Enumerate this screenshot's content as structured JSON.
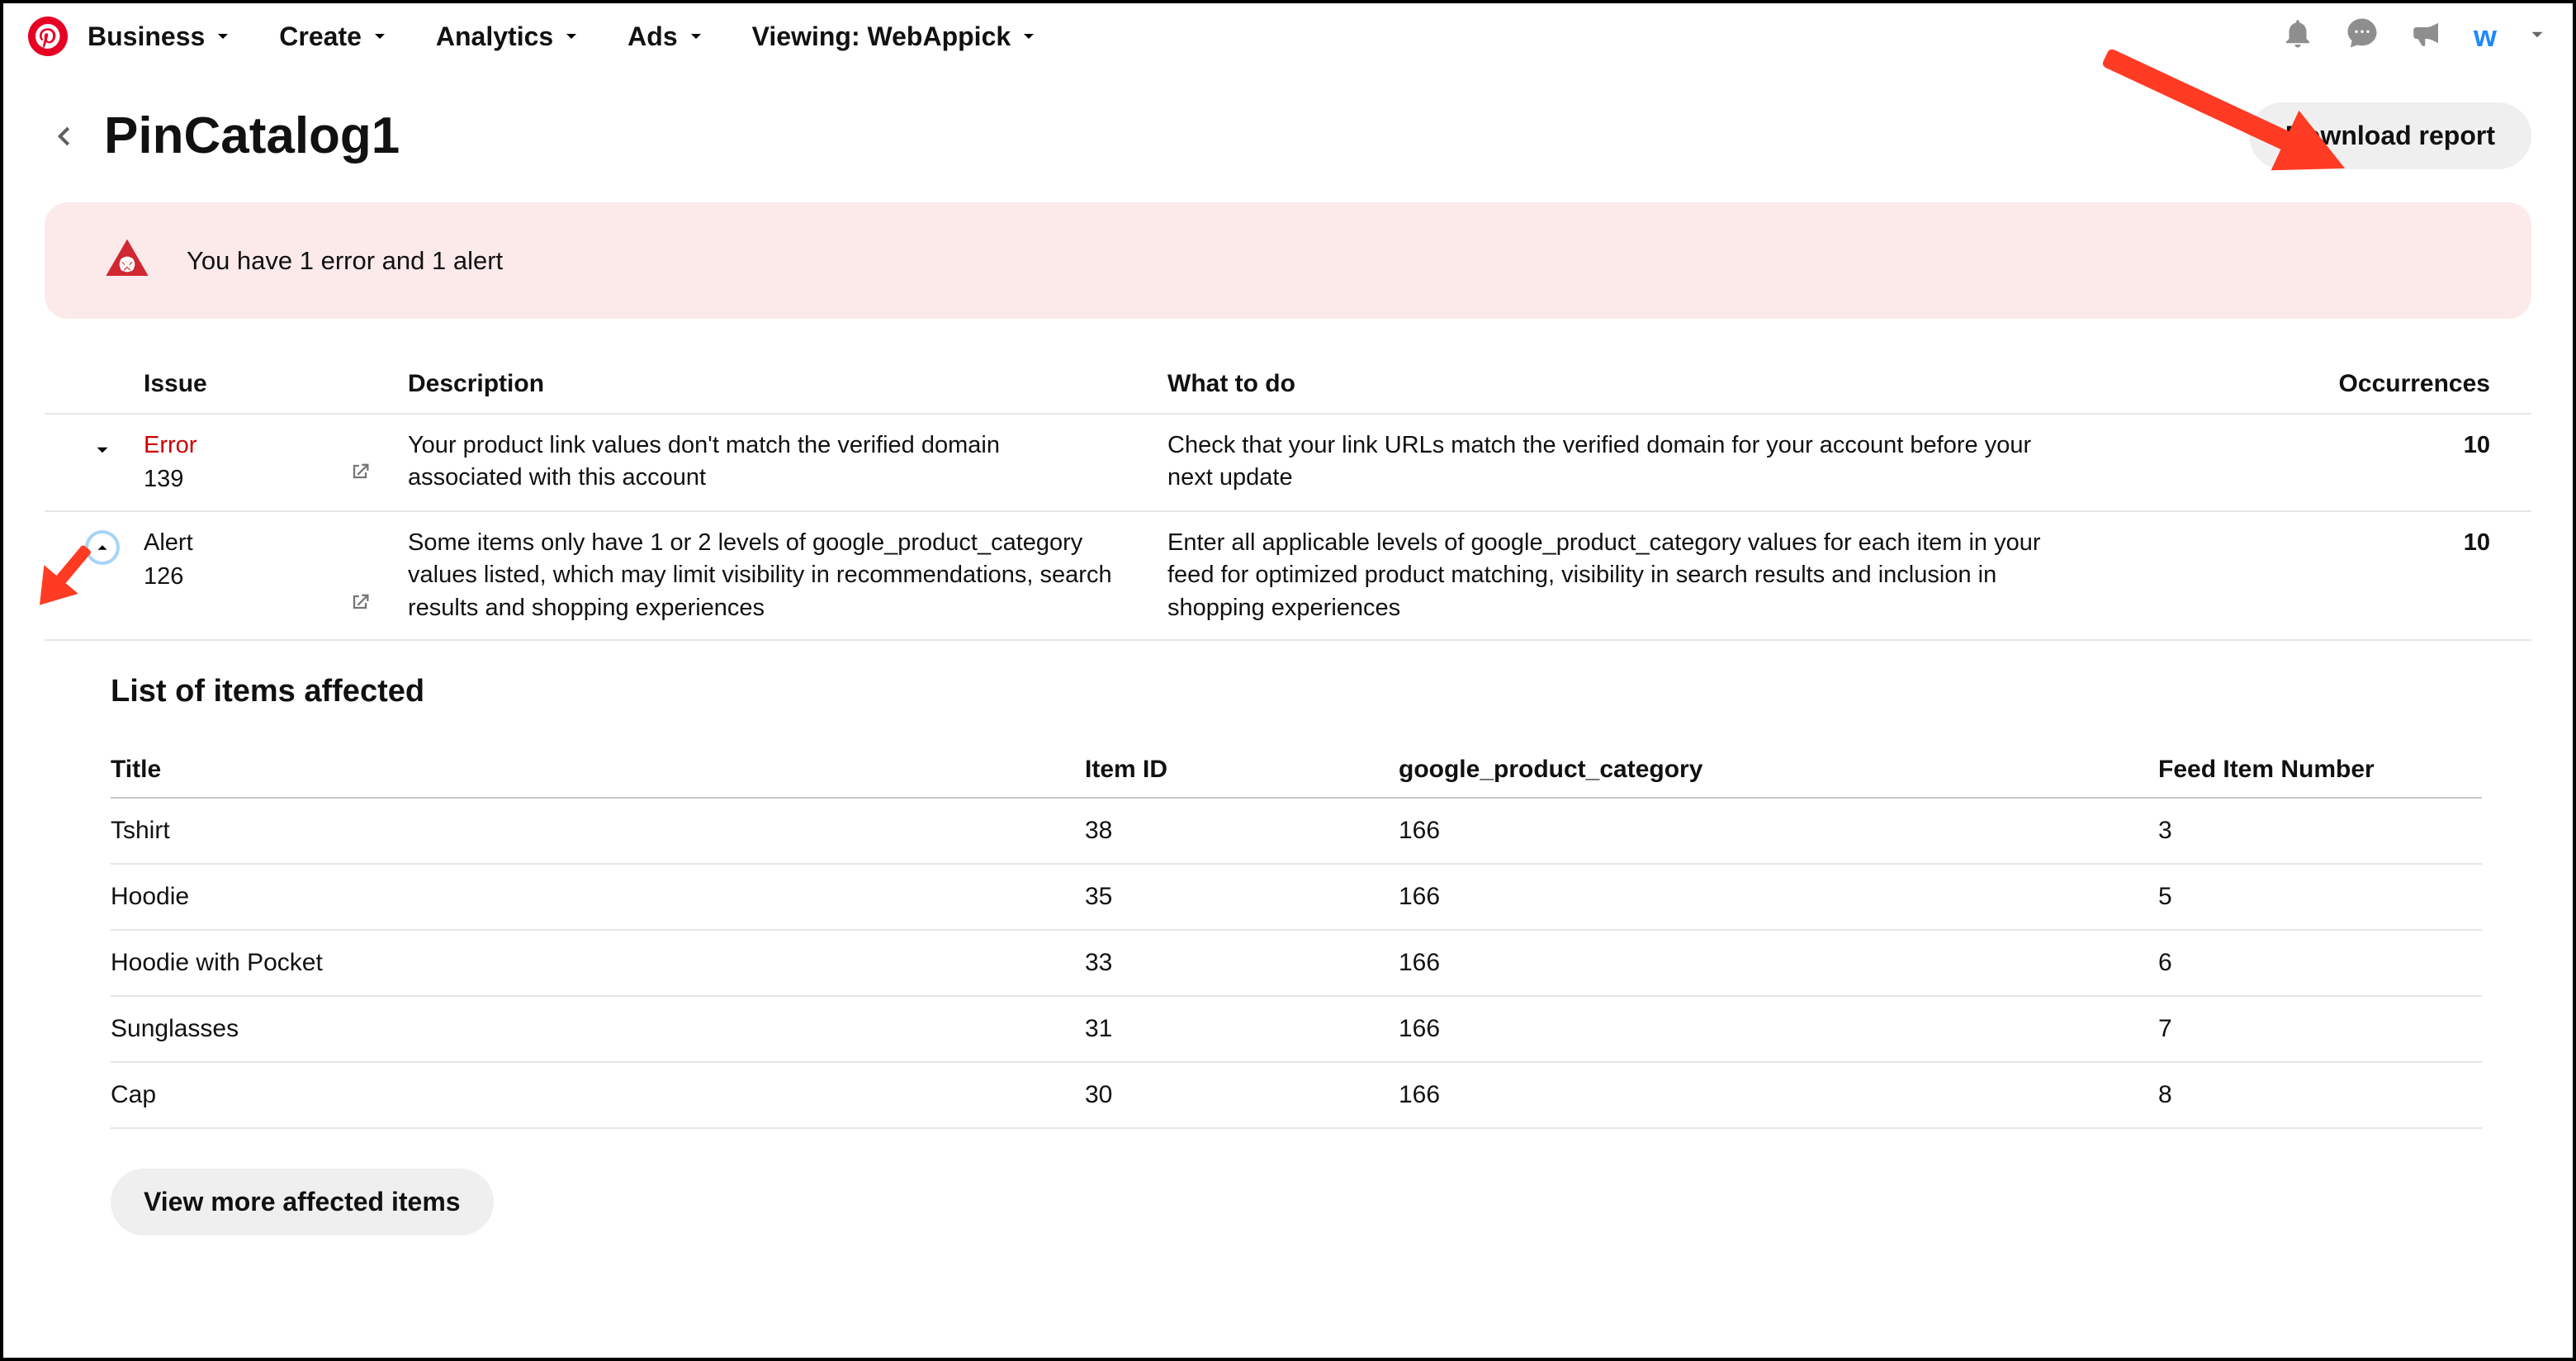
{
  "nav": {
    "items": [
      "Business",
      "Create",
      "Analytics",
      "Ads",
      "Viewing: WebAppick"
    ]
  },
  "page": {
    "title": "PinCatalog1",
    "download_label": "Download report",
    "banner": "You have 1 error and 1 alert"
  },
  "issues": {
    "header": {
      "issue": "Issue",
      "desc": "Description",
      "what": "What to do",
      "occ": "Occurrences"
    },
    "rows": [
      {
        "type": "Error",
        "code": "139",
        "description": "Your product link values don't match the verified domain associated with this account",
        "what": "Check that your link URLs match the verified domain for your account before your next update",
        "occurrences": "10",
        "expanded": false
      },
      {
        "type": "Alert",
        "code": "126",
        "description": "Some items only have 1 or 2 levels of google_product_category values listed, which may limit visibility in recommendations, search results and shopping experiences",
        "what": "Enter all applicable levels of google_product_category values for each item in your feed for optimized product matching, visibility in search results and inclusion in shopping experiences",
        "occurrences": "10",
        "expanded": true
      }
    ]
  },
  "affected": {
    "title": "List of items affected",
    "header": {
      "title": "Title",
      "id": "Item ID",
      "cat": "google_product_category",
      "num": "Feed Item Number"
    },
    "rows": [
      {
        "title": "Tshirt",
        "id": "38",
        "cat": "166",
        "num": "3"
      },
      {
        "title": "Hoodie",
        "id": "35",
        "cat": "166",
        "num": "5"
      },
      {
        "title": "Hoodie with Pocket",
        "id": "33",
        "cat": "166",
        "num": "6"
      },
      {
        "title": "Sunglasses",
        "id": "31",
        "cat": "166",
        "num": "7"
      },
      {
        "title": "Cap",
        "id": "30",
        "cat": "166",
        "num": "8"
      }
    ],
    "view_more": "View more affected items"
  }
}
